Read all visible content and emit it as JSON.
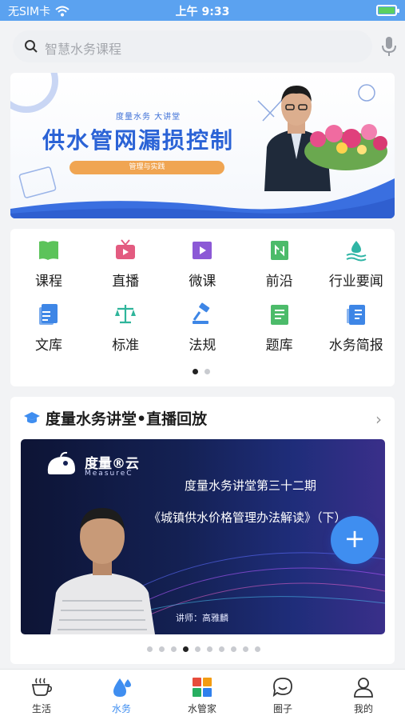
{
  "status_bar": {
    "carrier": "无SIM卡",
    "time": "上午 9:33"
  },
  "search": {
    "placeholder": "智慧水务课程"
  },
  "banner": {
    "small_title": "度量水务  大讲堂",
    "title": "供水管网漏损控制",
    "tag": "管理与实践"
  },
  "grid": {
    "items": [
      {
        "label": "课程",
        "icon": "book-icon",
        "color": "#5cc35a"
      },
      {
        "label": "直播",
        "icon": "tv-icon",
        "color": "#e35b80"
      },
      {
        "label": "微课",
        "icon": "video-icon",
        "color": "#8c59d6"
      },
      {
        "label": "前沿",
        "icon": "trend-icon",
        "color": "#4cbb6a"
      },
      {
        "label": "行业要闻",
        "icon": "water-icon",
        "color": "#2fb5a5"
      },
      {
        "label": "文库",
        "icon": "library-icon",
        "color": "#3e86e6"
      },
      {
        "label": "标准",
        "icon": "scale-icon",
        "color": "#2fb59b"
      },
      {
        "label": "法规",
        "icon": "gavel-icon",
        "color": "#3e86e6"
      },
      {
        "label": "题库",
        "icon": "document-icon",
        "color": "#4cbb6a"
      },
      {
        "label": "水务简报",
        "icon": "report-icon",
        "color": "#3e86e6"
      }
    ],
    "page_count": 2,
    "active_page": 1
  },
  "lecture": {
    "header": "度量水务讲堂•直播回放",
    "video": {
      "logo": "度量®云",
      "logo_sub": "MeasureC",
      "title_line1": "度量水务讲堂第三十二期",
      "title_line2": "《城镇供水价格管理办法解读》（下）",
      "lecturer": "讲师：高雅麟"
    },
    "page_count": 10,
    "active_page": 3
  },
  "tabbar": {
    "items": [
      {
        "label": "生活",
        "icon": "coffee-icon"
      },
      {
        "label": "水务",
        "icon": "droplet-icon",
        "active": true
      },
      {
        "label": "水管家",
        "icon": "grid-app-icon"
      },
      {
        "label": "圈子",
        "icon": "chat-icon"
      },
      {
        "label": "我的",
        "icon": "person-icon"
      }
    ]
  },
  "colors": {
    "accent": "#3f8ef0",
    "status_bar": "#5ba2f0"
  }
}
